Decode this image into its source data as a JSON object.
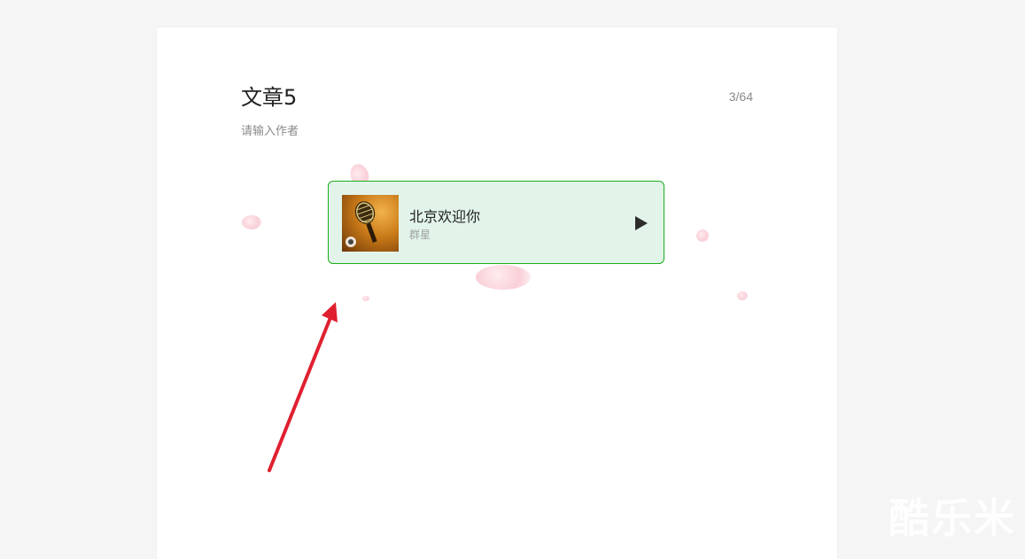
{
  "article": {
    "title": "文章5",
    "counter": "3/64",
    "author_placeholder": "请输入作者"
  },
  "music_card": {
    "song_title": "北京欢迎你",
    "artist": "群星",
    "play_icon": "play-icon",
    "album_icon": "microphone-icon"
  },
  "watermark": {
    "text": "酷乐米"
  },
  "colors": {
    "card_border": "#1aad19",
    "card_background": "#e2f4ea",
    "arrow": "#e02030",
    "page_background": "#f5f5f5"
  }
}
